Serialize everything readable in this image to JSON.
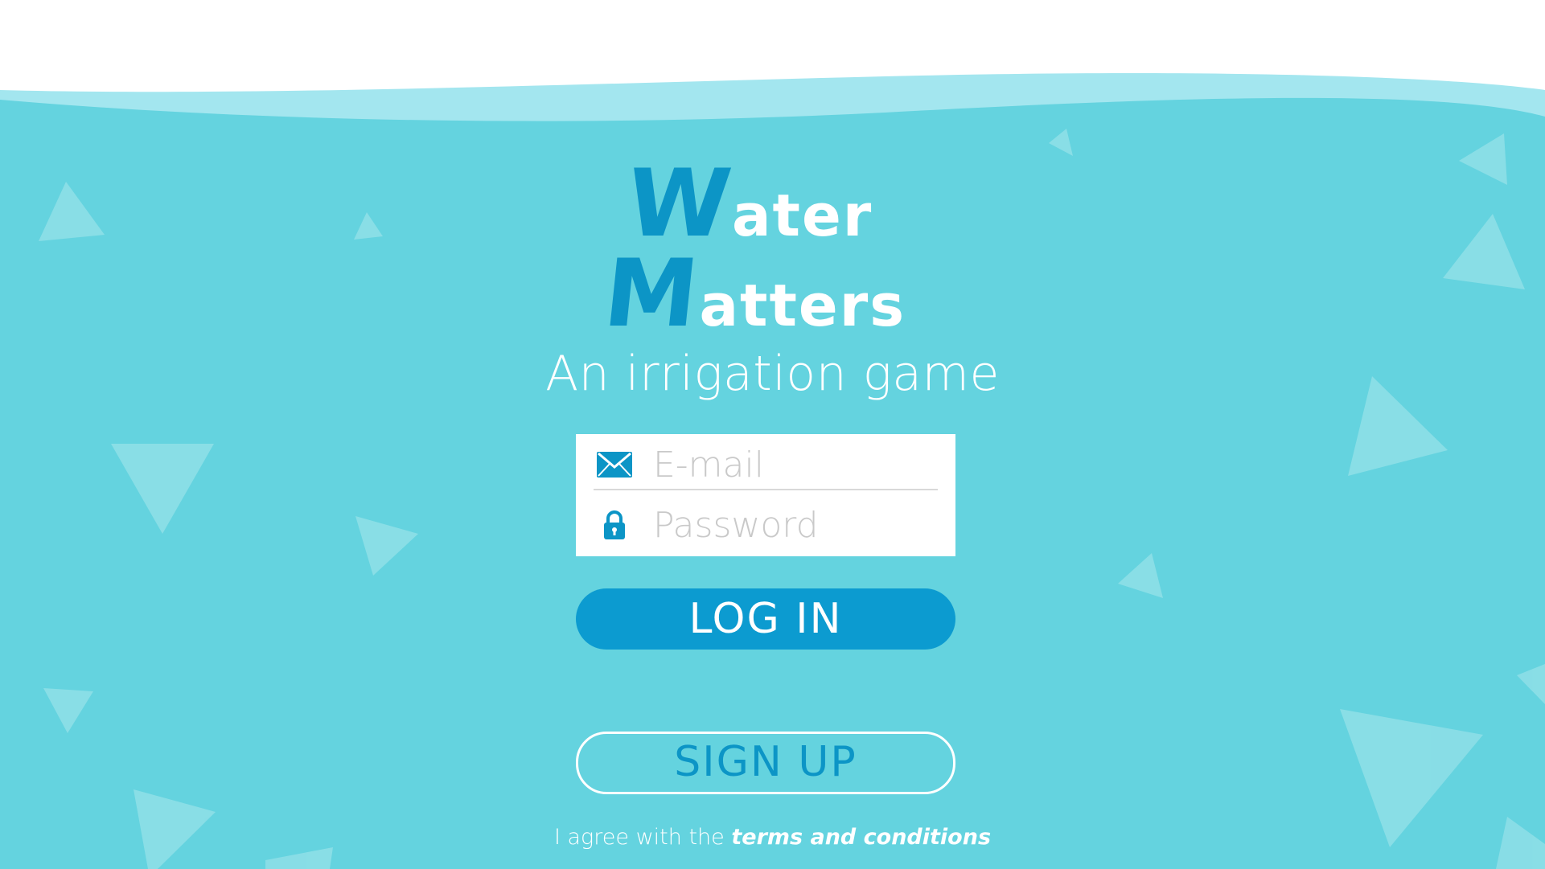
{
  "logo": {
    "line1_big": "W",
    "line1_small": "ater",
    "line2_big": "M",
    "line2_small": "atters"
  },
  "subtitle": "An irrigation game",
  "form": {
    "email_placeholder": "E-mail",
    "password_placeholder": "Password",
    "email_icon": "envelope-icon",
    "password_icon": "lock-icon"
  },
  "buttons": {
    "login_label": "LOG IN",
    "signup_label": "SIGN UP"
  },
  "terms": {
    "prefix": "I agree with the ",
    "link": "terms and conditions"
  },
  "colors": {
    "background": "#64d3df",
    "wave_light": "#a3e6ef",
    "accent": "#0c9bd0",
    "triangle": "#8fdfe8"
  }
}
